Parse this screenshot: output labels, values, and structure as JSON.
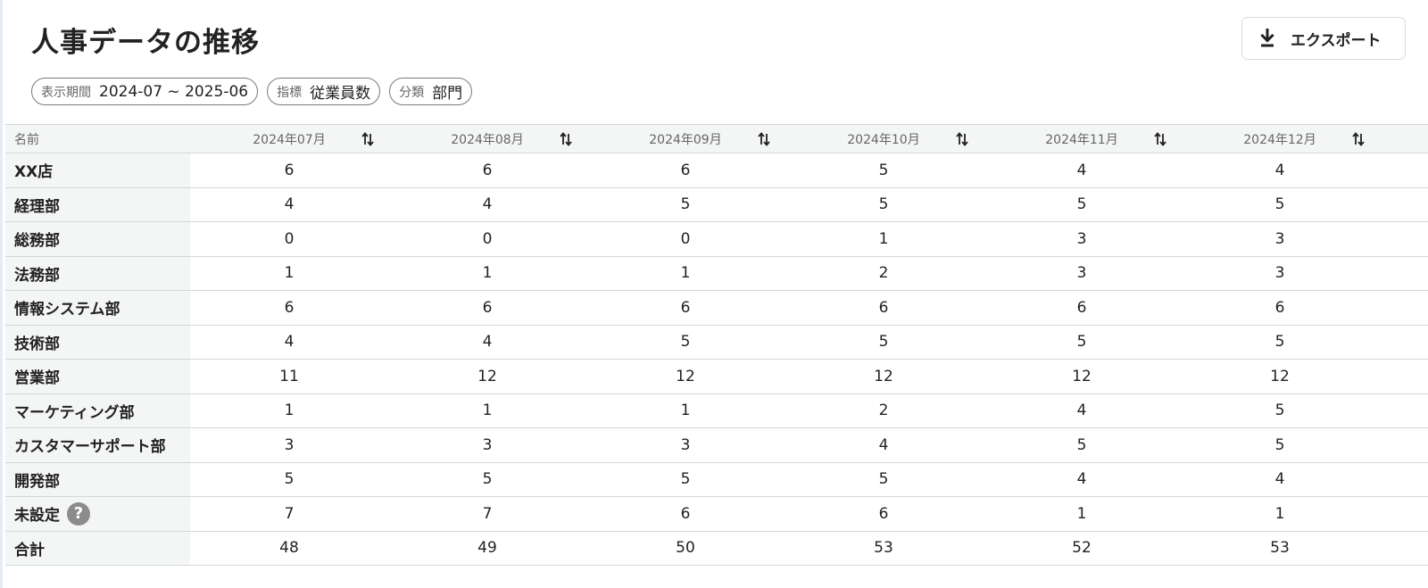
{
  "header": {
    "title": "人事データの推移",
    "export_label": "エクスポート"
  },
  "filters": [
    {
      "label": "表示期間",
      "value": "2024-07 ~ 2025-06"
    },
    {
      "label": "指標",
      "value": "従業員数"
    },
    {
      "label": "分類",
      "value": "部門"
    }
  ],
  "table": {
    "name_header": "名前",
    "columns": [
      "2024年07月",
      "2024年08月",
      "2024年09月",
      "2024年10月",
      "2024年11月",
      "2024年12月"
    ],
    "rows": [
      {
        "name": "XX店",
        "values": [
          "6",
          "6",
          "6",
          "5",
          "4",
          "4"
        ]
      },
      {
        "name": "経理部",
        "values": [
          "4",
          "4",
          "5",
          "5",
          "5",
          "5"
        ]
      },
      {
        "name": "総務部",
        "values": [
          "0",
          "0",
          "0",
          "1",
          "3",
          "3"
        ]
      },
      {
        "name": "法務部",
        "values": [
          "1",
          "1",
          "1",
          "2",
          "3",
          "3"
        ]
      },
      {
        "name": "情報システム部",
        "values": [
          "6",
          "6",
          "6",
          "6",
          "6",
          "6"
        ]
      },
      {
        "name": "技術部",
        "values": [
          "4",
          "4",
          "5",
          "5",
          "5",
          "5"
        ]
      },
      {
        "name": "営業部",
        "values": [
          "11",
          "12",
          "12",
          "12",
          "12",
          "12"
        ]
      },
      {
        "name": "マーケティング部",
        "values": [
          "1",
          "1",
          "1",
          "2",
          "4",
          "5"
        ]
      },
      {
        "name": "カスタマーサポート部",
        "values": [
          "3",
          "3",
          "3",
          "4",
          "5",
          "5"
        ]
      },
      {
        "name": "開発部",
        "values": [
          "5",
          "5",
          "5",
          "5",
          "4",
          "4"
        ]
      },
      {
        "name": "未設定",
        "values": [
          "7",
          "7",
          "6",
          "6",
          "1",
          "1"
        ],
        "help": "?"
      },
      {
        "name": "合計",
        "values": [
          "48",
          "49",
          "50",
          "53",
          "52",
          "53"
        ]
      }
    ]
  },
  "icons": {
    "export": "download-icon",
    "sort": "sort-icon",
    "help": "help-icon"
  }
}
